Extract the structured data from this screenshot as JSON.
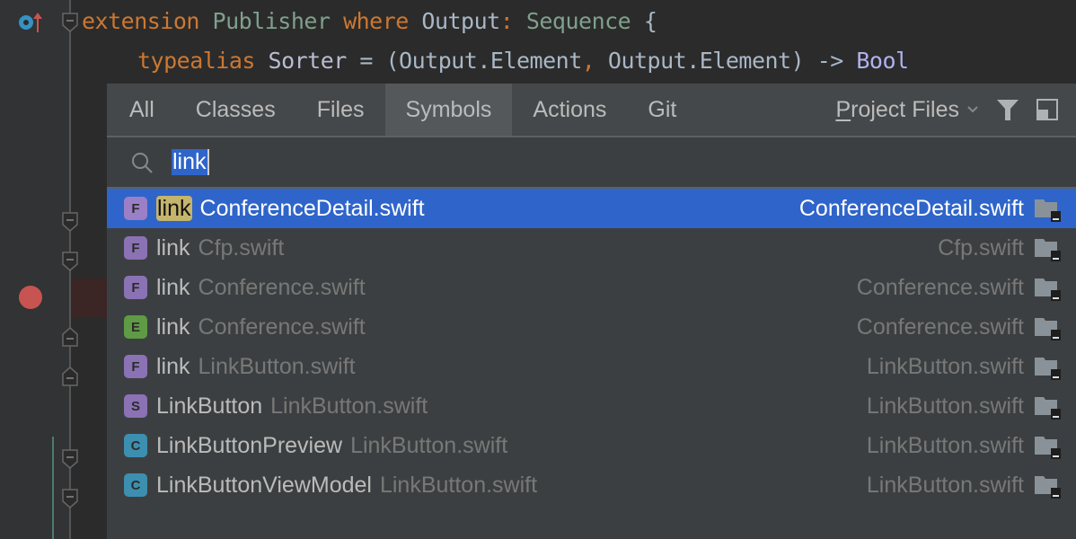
{
  "editor": {
    "line1": {
      "kw1": "extension",
      "type1": "Publisher",
      "kw2": "where",
      "ident1": "Output",
      "colon": ":",
      "type2": "Sequence",
      "brace": "{"
    },
    "line2": {
      "kw": "typealias",
      "ident": "Sorter",
      "rest": " = (Output.Element",
      "comma": ",",
      "rest2": " Output.Element) -> ",
      "bool": "Bool"
    }
  },
  "popup": {
    "tabs": [
      {
        "label": "All",
        "active": false
      },
      {
        "label": "Classes",
        "active": false
      },
      {
        "label": "Files",
        "active": false
      },
      {
        "label": "Symbols",
        "active": true
      },
      {
        "label": "Actions",
        "active": false
      },
      {
        "label": "Git",
        "active": false
      }
    ],
    "scope": {
      "mnemonic": "P",
      "rest": "roject Files"
    },
    "search": {
      "value": "link"
    },
    "results": [
      {
        "kind": "F",
        "color": "#9b7fc7",
        "highlight": "link",
        "name": "",
        "file": "ConferenceDetail.swift",
        "location": "ConferenceDetail.swift",
        "selected": true
      },
      {
        "kind": "F",
        "color": "#8b72b5",
        "highlight": "",
        "name": "link",
        "file": "Cfp.swift",
        "location": "Cfp.swift",
        "selected": false
      },
      {
        "kind": "F",
        "color": "#8b72b5",
        "highlight": "",
        "name": "link",
        "file": "Conference.swift",
        "location": "Conference.swift",
        "selected": false
      },
      {
        "kind": "E",
        "color": "#5f9a45",
        "highlight": "",
        "name": "link",
        "file": "Conference.swift",
        "location": "Conference.swift",
        "selected": false
      },
      {
        "kind": "F",
        "color": "#8b72b5",
        "highlight": "",
        "name": "link",
        "file": "LinkButton.swift",
        "location": "LinkButton.swift",
        "selected": false
      },
      {
        "kind": "S",
        "color": "#8b72b5",
        "highlight": "",
        "name": "LinkButton",
        "file": "LinkButton.swift",
        "location": "LinkButton.swift",
        "selected": false
      },
      {
        "kind": "C",
        "color": "#3d8fb0",
        "highlight": "",
        "name": "LinkButtonPreview",
        "file": "LinkButton.swift",
        "location": "LinkButton.swift",
        "selected": false
      },
      {
        "kind": "C",
        "color": "#3d8fb0",
        "highlight": "",
        "name": "LinkButtonViewModel",
        "file": "LinkButton.swift",
        "location": "LinkButton.swift",
        "selected": false
      }
    ]
  },
  "colors": {
    "selection": "#2f65ca",
    "match_highlight": "#c5b46b",
    "breakpoint": "#c75450"
  }
}
